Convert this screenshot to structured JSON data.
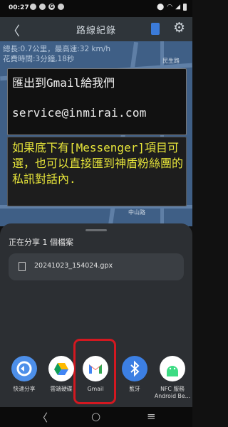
{
  "status_bar": {
    "time": "00:27",
    "notif_letter": "G"
  },
  "app_bar": {
    "back": "〈",
    "title": "路線紀錄",
    "settings_icon": "⚙"
  },
  "stats": {
    "line1": "總長:0.7公里，最高速:32 km/h",
    "line2": "花費時間:3分鐘,18秒"
  },
  "map_labels": [
    "民生路",
    "中山路"
  ],
  "callout_1": {
    "line1": "匯出到Gmail給我們",
    "line2": "service@inmirai.com"
  },
  "callout_2": {
    "text": "如果底下有[Messenger]項目可選，也可以直接匯到神盾粉絲團的私訊對話內."
  },
  "share_sheet": {
    "title": "正在分享 1 個檔案",
    "file_name": "20241023_154024.gpx",
    "apps": [
      {
        "label": "快速分享"
      },
      {
        "label": "雲端硬碟"
      },
      {
        "label": "Gmail"
      },
      {
        "label": "藍牙"
      },
      {
        "label": "NFC 服務",
        "sublabel": "Android Be..."
      }
    ]
  },
  "nav_bar": {
    "back": "〈",
    "home": "○",
    "recents": "≡"
  },
  "colors": {
    "highlight": "#d31820",
    "callout_text": "#e6e43a"
  }
}
